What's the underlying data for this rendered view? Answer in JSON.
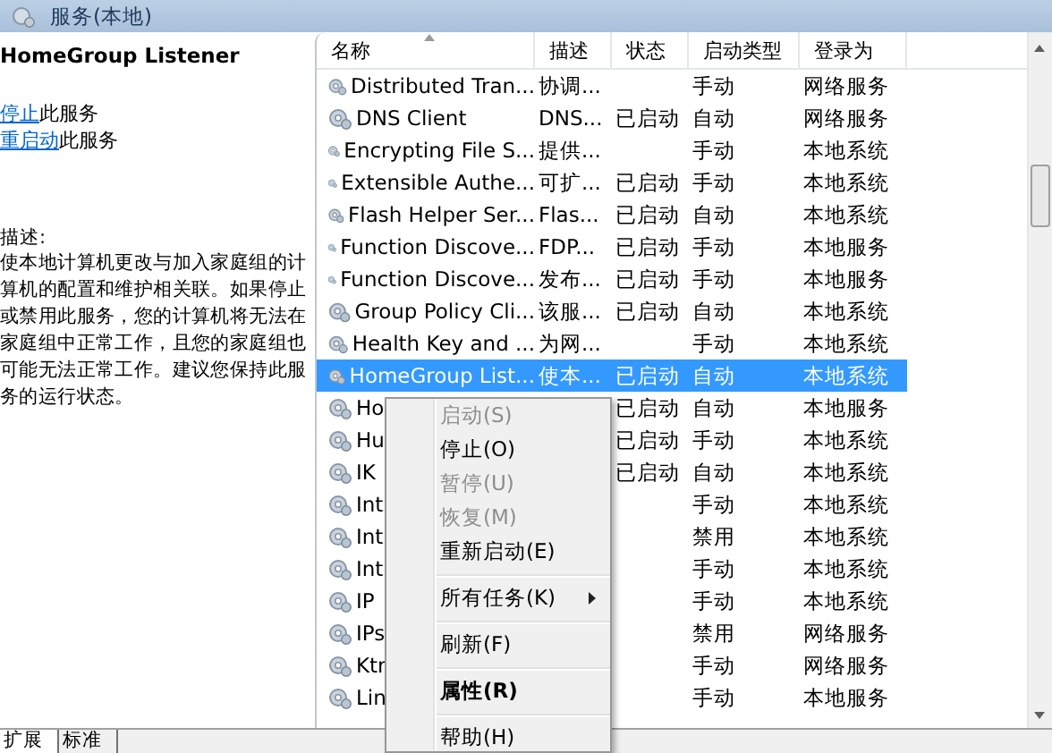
{
  "window": {
    "title": "服务(本地)"
  },
  "detail": {
    "service_name": "HomeGroup Listener",
    "actions": [
      {
        "link": "停止",
        "text": "此服务"
      },
      {
        "link": "重启动",
        "text": "此服务"
      }
    ],
    "description_label": "描述:",
    "description": "使本地计算机更改与加入家庭组的计算机的配置和维护相关联。如果停止或禁用此服务，您的计算机将无法在家庭组中正常工作，且您的家庭组也可能无法正常工作。建议您保持此服务的运行状态。"
  },
  "table": {
    "columns": [
      "名称",
      "描述",
      "状态",
      "启动类型",
      "登录为"
    ],
    "rows": [
      {
        "name": "Distributed Tran...",
        "description": "协调...",
        "status": "",
        "startup": "手动",
        "logon": "网络服务",
        "selected": false
      },
      {
        "name": "DNS Client",
        "description": "DNS...",
        "status": "已启动",
        "startup": "自动",
        "logon": "网络服务",
        "selected": false
      },
      {
        "name": "Encrypting File S...",
        "description": "提供...",
        "status": "",
        "startup": "手动",
        "logon": "本地系统",
        "selected": false
      },
      {
        "name": "Extensible Authe...",
        "description": "可扩...",
        "status": "已启动",
        "startup": "手动",
        "logon": "本地系统",
        "selected": false
      },
      {
        "name": "Flash Helper Ser...",
        "description": "Flas...",
        "status": "已启动",
        "startup": "自动",
        "logon": "本地系统",
        "selected": false
      },
      {
        "name": "Function Discove...",
        "description": "FDP...",
        "status": "已启动",
        "startup": "手动",
        "logon": "本地服务",
        "selected": false
      },
      {
        "name": "Function Discove...",
        "description": "发布...",
        "status": "已启动",
        "startup": "手动",
        "logon": "本地服务",
        "selected": false
      },
      {
        "name": "Group Policy Cli...",
        "description": "该服...",
        "status": "已启动",
        "startup": "自动",
        "logon": "本地系统",
        "selected": false
      },
      {
        "name": "Health Key and ...",
        "description": "为网...",
        "status": "",
        "startup": "手动",
        "logon": "本地系统",
        "selected": false
      },
      {
        "name": "HomeGroup List...",
        "description": "使本...",
        "status": "已启动",
        "startup": "自动",
        "logon": "本地系统",
        "selected": true
      },
      {
        "name": "Ho",
        "description": "",
        "status": "已启动",
        "startup": "自动",
        "logon": "本地服务",
        "selected": false
      },
      {
        "name": "Hu",
        "description": "",
        "status": "已启动",
        "startup": "手动",
        "logon": "本地系统",
        "selected": false
      },
      {
        "name": "IK",
        "description": "",
        "status": "已启动",
        "startup": "自动",
        "logon": "本地系统",
        "selected": false
      },
      {
        "name": "Int",
        "description": "",
        "status": "",
        "startup": "手动",
        "logon": "本地系统",
        "selected": false
      },
      {
        "name": "Int",
        "description": "",
        "status": "",
        "startup": "禁用",
        "logon": "本地系统",
        "selected": false
      },
      {
        "name": "Int",
        "description": "",
        "status": "",
        "startup": "手动",
        "logon": "本地系统",
        "selected": false
      },
      {
        "name": "IP",
        "description": "",
        "status": "",
        "startup": "手动",
        "logon": "本地系统",
        "selected": false
      },
      {
        "name": "IPs",
        "description": "",
        "status": "",
        "startup": "禁用",
        "logon": "网络服务",
        "selected": false
      },
      {
        "name": "Ktr",
        "description": "",
        "status": "",
        "startup": "手动",
        "logon": "网络服务",
        "selected": false
      },
      {
        "name": "Lin",
        "description": "",
        "status": "",
        "startup": "手动",
        "logon": "本地服务",
        "selected": false
      }
    ]
  },
  "context_menu": {
    "items": [
      {
        "kind": "command",
        "label": "启动(S)",
        "disabled": true,
        "default": false
      },
      {
        "kind": "command",
        "label": "停止(O)",
        "disabled": false,
        "default": false
      },
      {
        "kind": "command",
        "label": "暂停(U)",
        "disabled": true,
        "default": false
      },
      {
        "kind": "command",
        "label": "恢复(M)",
        "disabled": true,
        "default": false
      },
      {
        "kind": "command",
        "label": "重新启动(E)",
        "disabled": false,
        "default": false
      },
      {
        "kind": "separator"
      },
      {
        "kind": "submenu",
        "label": "所有任务(K)",
        "disabled": false,
        "default": false
      },
      {
        "kind": "separator"
      },
      {
        "kind": "command",
        "label": "刷新(F)",
        "disabled": false,
        "default": false
      },
      {
        "kind": "separator"
      },
      {
        "kind": "command",
        "label": "属性(R)",
        "disabled": false,
        "default": true
      },
      {
        "kind": "separator"
      },
      {
        "kind": "command",
        "label": "帮助(H)",
        "disabled": false,
        "default": false
      }
    ]
  },
  "bottom_tabs": [
    {
      "label": "扩展",
      "selected": true
    },
    {
      "label": "标准",
      "selected": false
    }
  ]
}
